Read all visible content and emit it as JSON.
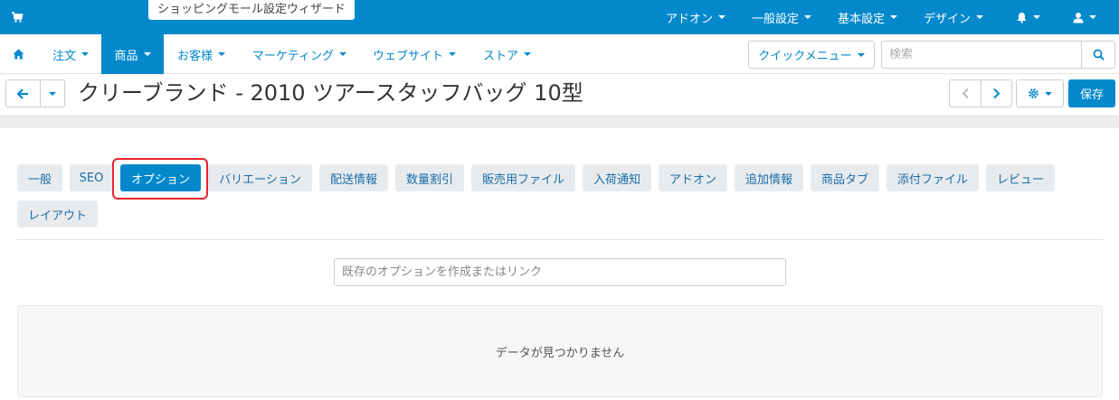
{
  "topbar": {
    "wizard_label": "ショッピングモール設定ウィザード",
    "addons": "アドオン",
    "general_settings": "一般設定",
    "basic_settings": "基本設定",
    "design": "デザイン",
    "bg_color": "#0388cc"
  },
  "mainnav": {
    "items": [
      {
        "label": "注文"
      },
      {
        "label": "商品"
      },
      {
        "label": "お客様"
      },
      {
        "label": "マーケティング"
      },
      {
        "label": "ウェブサイト"
      },
      {
        "label": "ストア"
      }
    ],
    "active": "商品",
    "quick_menu": "クイックメニュー",
    "search_placeholder": "検索"
  },
  "titlebar": {
    "title": "クリーブランド - 2010 ツアースタッフバッグ 10型",
    "save_label": "保存"
  },
  "tabs": [
    {
      "label": "一般"
    },
    {
      "label": "SEO"
    },
    {
      "label": "オプション"
    },
    {
      "label": "バリエーション"
    },
    {
      "label": "配送情報"
    },
    {
      "label": "数量割引"
    },
    {
      "label": "販売用ファイル"
    },
    {
      "label": "入荷通知"
    },
    {
      "label": "アドオン"
    },
    {
      "label": "追加情報"
    },
    {
      "label": "商品タブ"
    },
    {
      "label": "添付ファイル"
    },
    {
      "label": "レビュー"
    },
    {
      "label": "レイアウト"
    }
  ],
  "active_tab": "オプション",
  "options": {
    "input_placeholder": "既存のオプションを作成またはリンク",
    "empty_message": "データが見つかりません"
  }
}
